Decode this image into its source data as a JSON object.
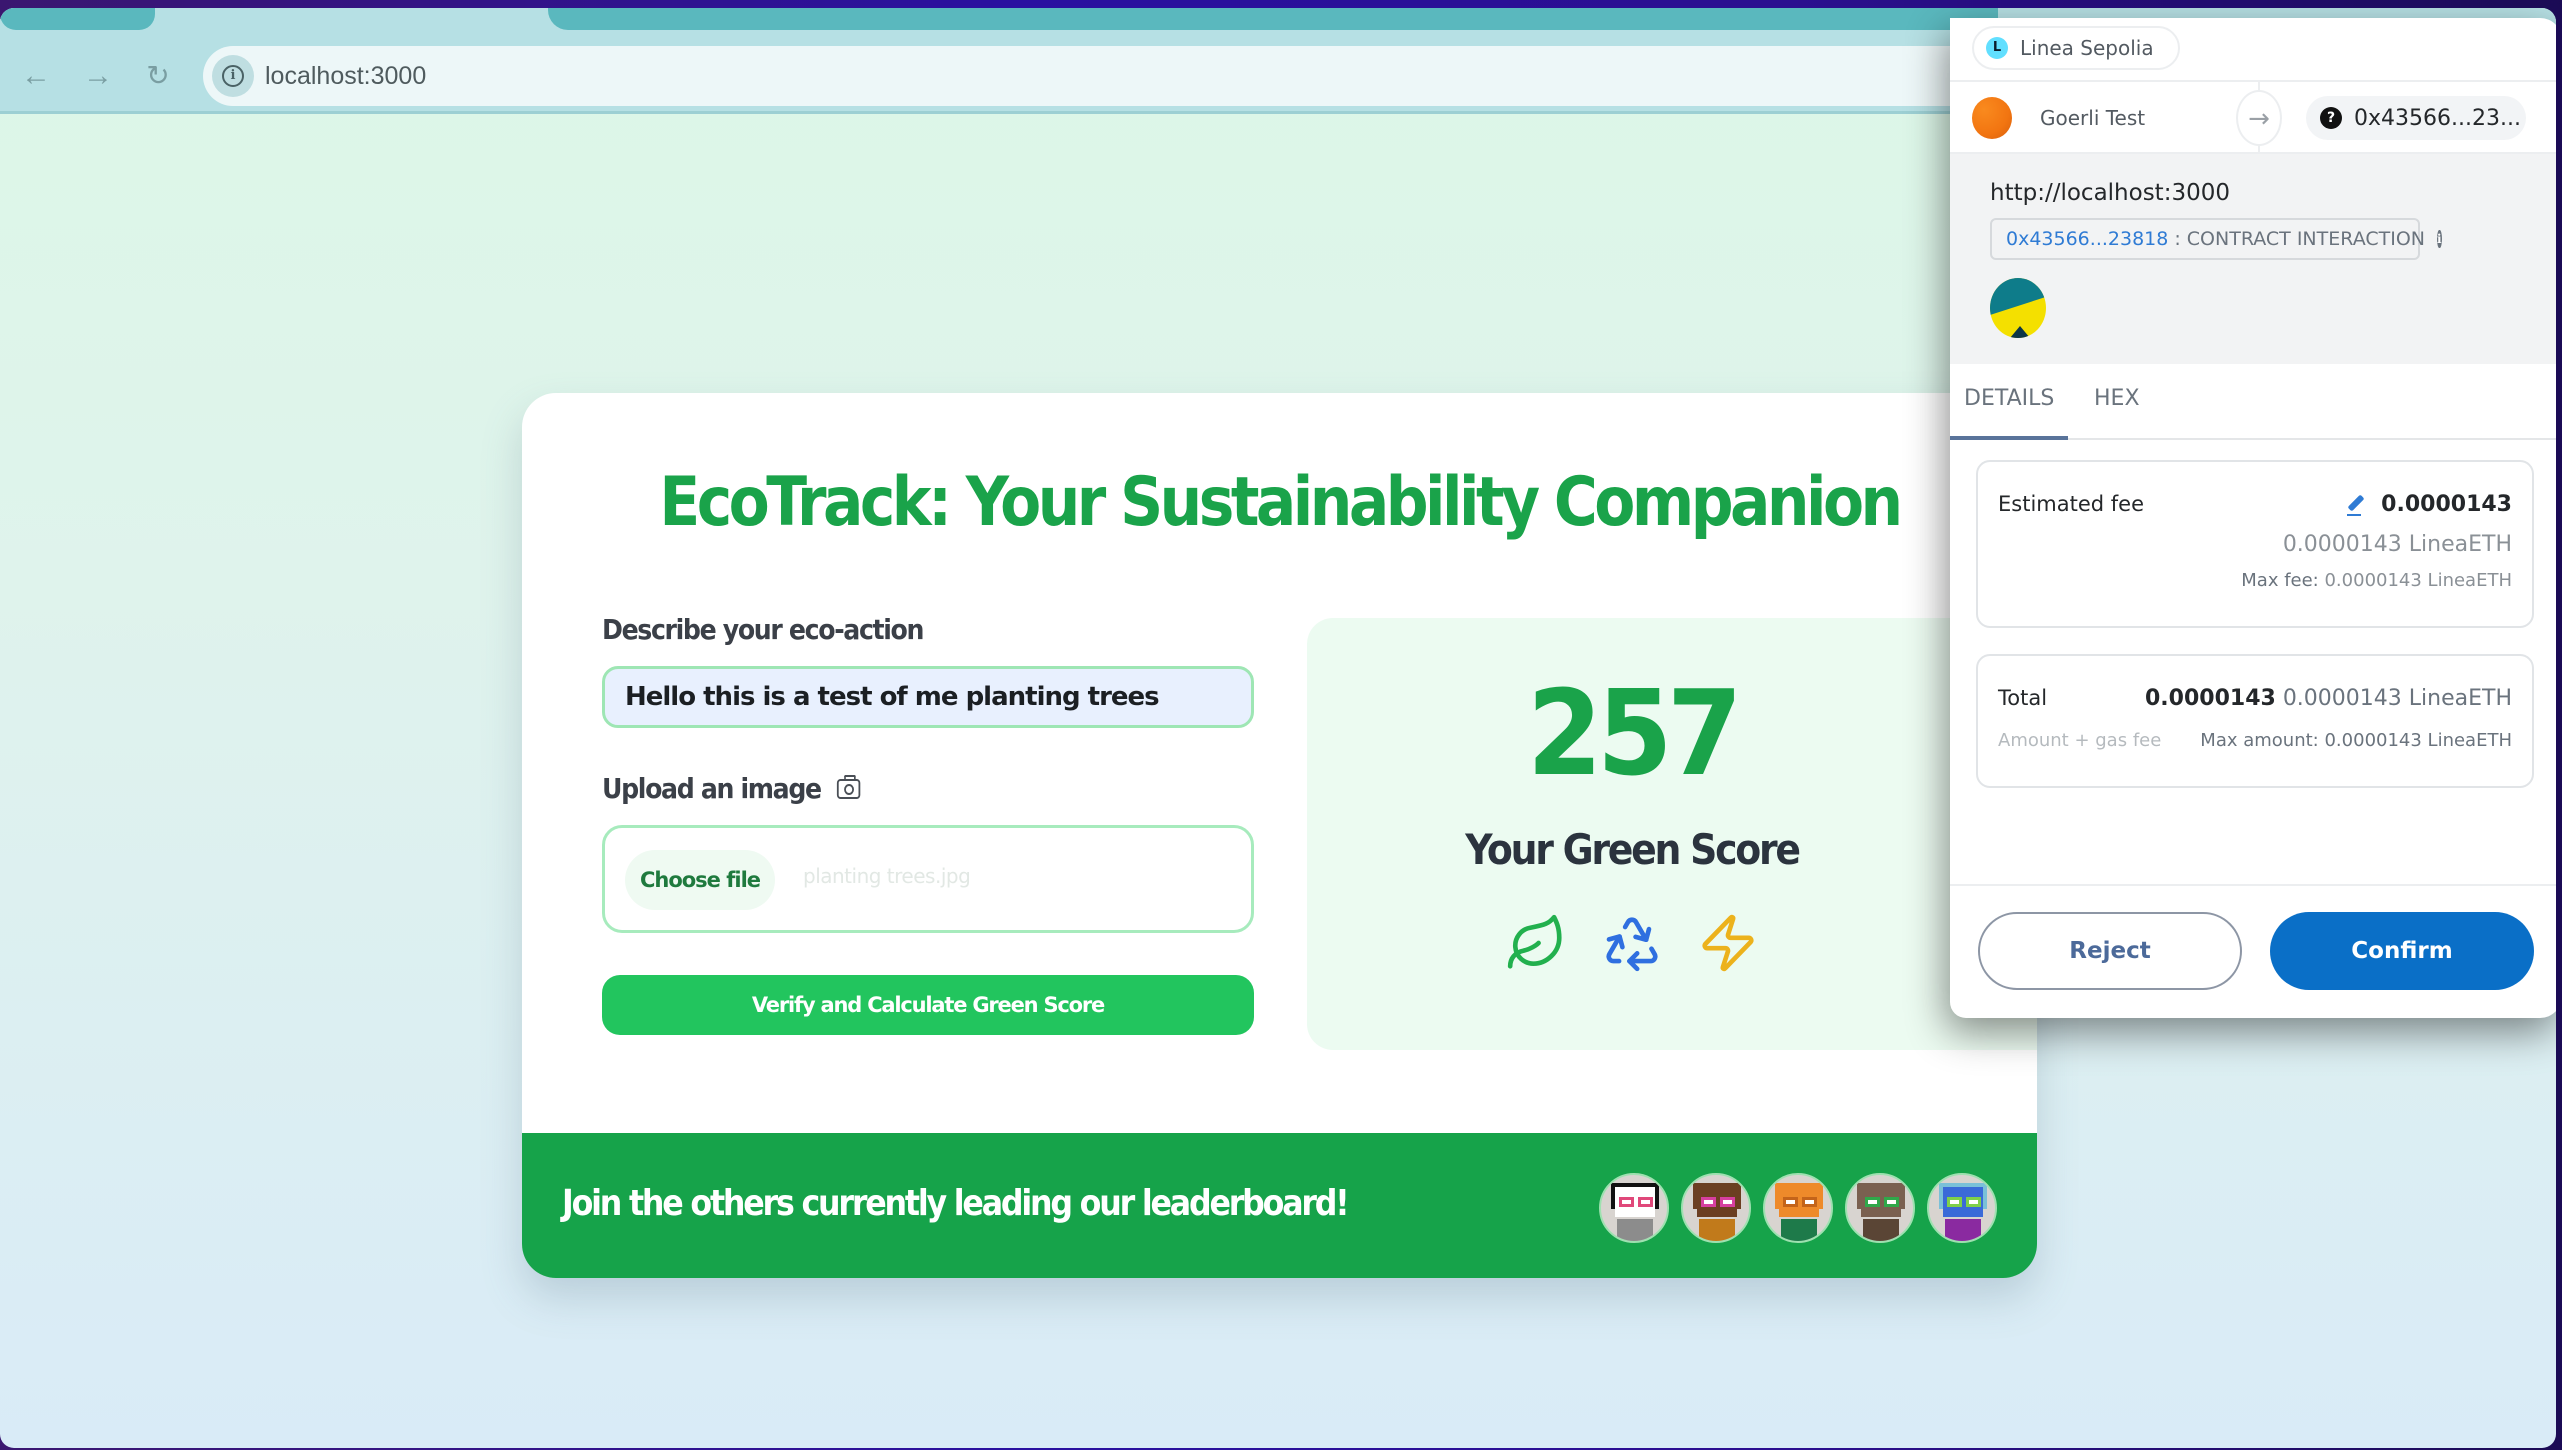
{
  "browser": {
    "url": "localhost:3000",
    "nav": {
      "back_icon": "←",
      "forward_icon": "→",
      "reload_icon": "↻",
      "site_info_icon": "i"
    }
  },
  "app": {
    "title": "EcoTrack: Your Sustainability Companion",
    "form": {
      "description_label": "Describe your eco-action",
      "description_value": "Hello this is a test of me planting trees",
      "upload_label": "Upload an image",
      "choose_file_label": "Choose file",
      "file_name": "planting trees.jpg",
      "verify_button": "Verify and Calculate Green Score"
    },
    "score": {
      "value": "257",
      "label": "Your Green Score",
      "icons": [
        {
          "name": "leaf-icon",
          "color": "#22b04e"
        },
        {
          "name": "recycle-icon",
          "color": "#2f6fe0"
        },
        {
          "name": "lightning-icon",
          "color": "#ecb21c"
        }
      ]
    },
    "footer": {
      "text": "Join the others currently leading our leaderboard!",
      "avatars": [
        {
          "name": "panda",
          "head": "#ffffff",
          "ear": "#111111",
          "glasses": "#e0487a",
          "body": "#8c8c8c"
        },
        {
          "name": "fish",
          "head": "#6b3f22",
          "ear": "#6b3f22",
          "glasses": "#d63fa0",
          "body": "#c17a1b"
        },
        {
          "name": "fox",
          "head": "#ee8a2a",
          "ear": "#ee8a2a",
          "glasses": "#c4641a",
          "body": "#1e7a4a"
        },
        {
          "name": "goat",
          "head": "#7a6050",
          "ear": "#7a6050",
          "glasses": "#2fa84a",
          "body": "#5a4535"
        },
        {
          "name": "jar",
          "head": "#3a6ad8",
          "ear": "#7ac0d8",
          "glasses": "#7fd04a",
          "body": "#8a2aa0"
        }
      ]
    },
    "colors": {
      "brand_green": "#16a34a",
      "button_green": "#22c55e"
    }
  },
  "wallet": {
    "network": "Linea Sepolia",
    "network_icon": "L",
    "from_account": "Goerli Test",
    "to_address": "0x43566...23...",
    "origin": "http://localhost:3000",
    "contract_address": "0x43566...23818",
    "contract_label": ": CONTRACT INTERACTION",
    "tabs": [
      "DETAILS",
      "HEX"
    ],
    "active_tab": "DETAILS",
    "estimated_fee": {
      "label": "Estimated fee",
      "value": "0.0000143",
      "converted": "0.0000143 LineaETH",
      "max_fee_label": "Max fee:",
      "max_fee_value": "0.0000143 LineaETH"
    },
    "total": {
      "label": "Total",
      "value": "0.0000143",
      "converted": "0.0000143 LineaETH",
      "sub_label": "Amount + gas fee",
      "max_amount_label": "Max amount:",
      "max_amount_value": "0.0000143 LineaETH"
    },
    "reject_button": "Reject",
    "confirm_button": "Confirm",
    "colors": {
      "primary": "#0a6fc7",
      "link": "#2f7bd4"
    }
  }
}
